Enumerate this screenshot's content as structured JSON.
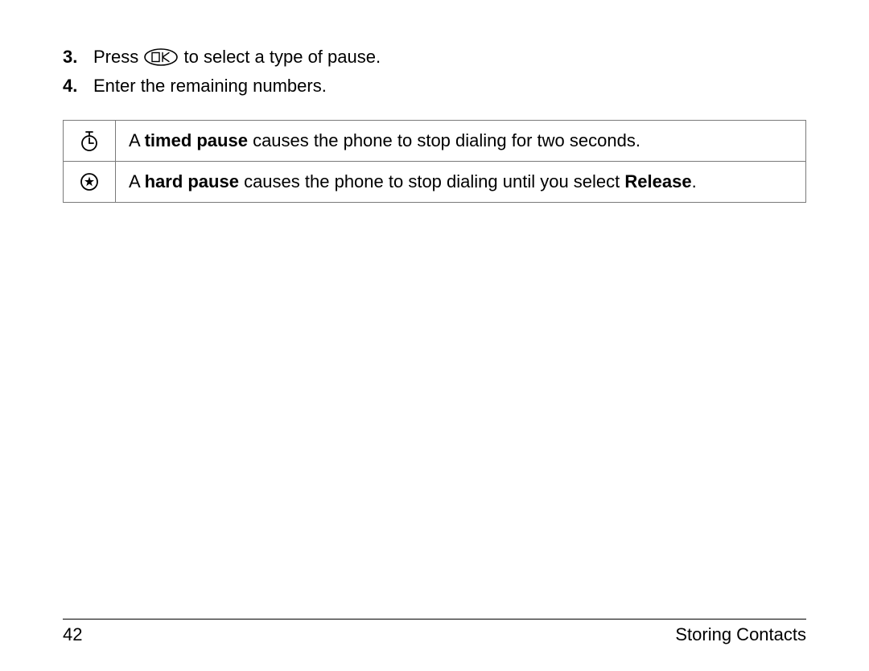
{
  "steps": [
    {
      "num": "3.",
      "text_before": "Press ",
      "key_label": "OK",
      "text_after": " to select a type of pause."
    },
    {
      "num": "4.",
      "text": "Enter the remaining numbers."
    }
  ],
  "pause_table": {
    "rows": [
      {
        "icon_name": "stopwatch-icon",
        "text_pre": "A ",
        "bold": "timed pause",
        "text_post": " causes the phone to stop dialing for two seconds."
      },
      {
        "icon_name": "star-circle-icon",
        "text_pre": "A ",
        "bold": "hard pause",
        "text_post": " causes the phone to stop dialing until you select ",
        "bold2": "Release",
        "text_end": "."
      }
    ]
  },
  "footer": {
    "page_number": "42",
    "section": "Storing Contacts"
  }
}
